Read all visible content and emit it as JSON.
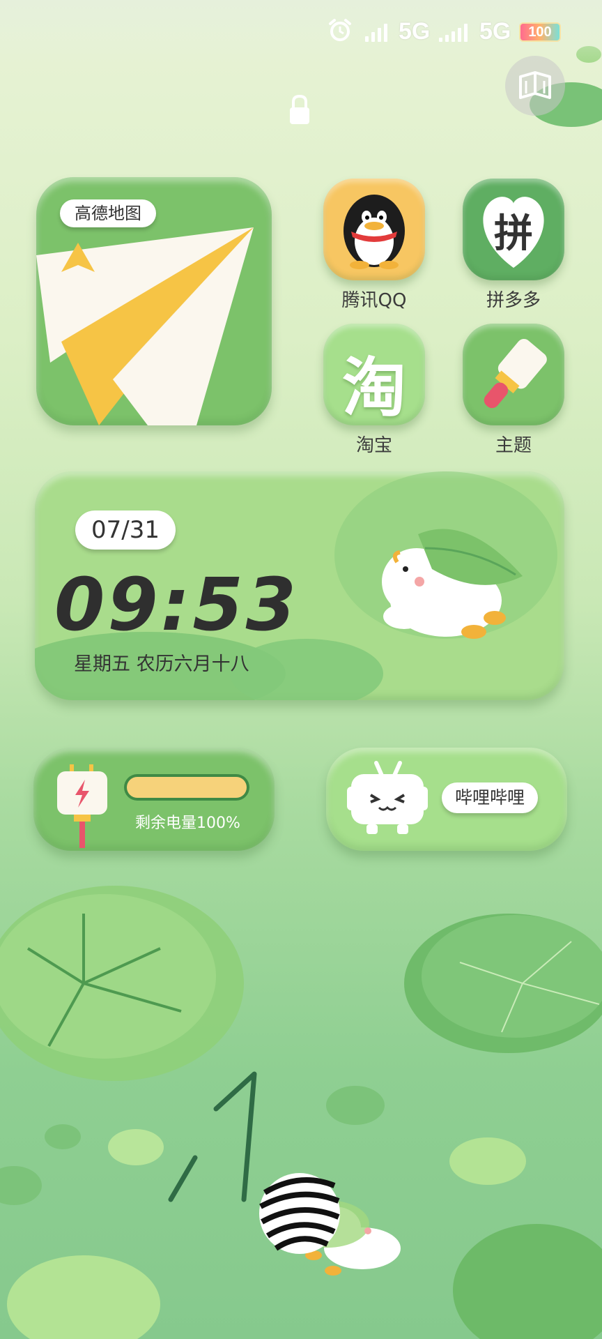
{
  "status_bar": {
    "network_1": "5G",
    "network_2": "5G",
    "battery": "100"
  },
  "apps": {
    "amap": {
      "label": "高德地图"
    },
    "qq": {
      "label": "腾讯QQ"
    },
    "pinduoduo": {
      "label": "拼多多",
      "glyph": "拼"
    },
    "taobao": {
      "label": "淘宝",
      "glyph": "淘"
    },
    "theme": {
      "label": "主题"
    },
    "bilibili": {
      "label": "哔哩哔哩"
    }
  },
  "clock_widget": {
    "date": "07/31",
    "time": "09:53",
    "day_info": "星期五 农历六月十八"
  },
  "battery_widget": {
    "text": "剩余电量100%",
    "level": 1.0
  },
  "colors": {
    "accent_green": "#7cc26a",
    "clock_text": "#2f2f2f",
    "battery_fill": "#f6d27a"
  }
}
